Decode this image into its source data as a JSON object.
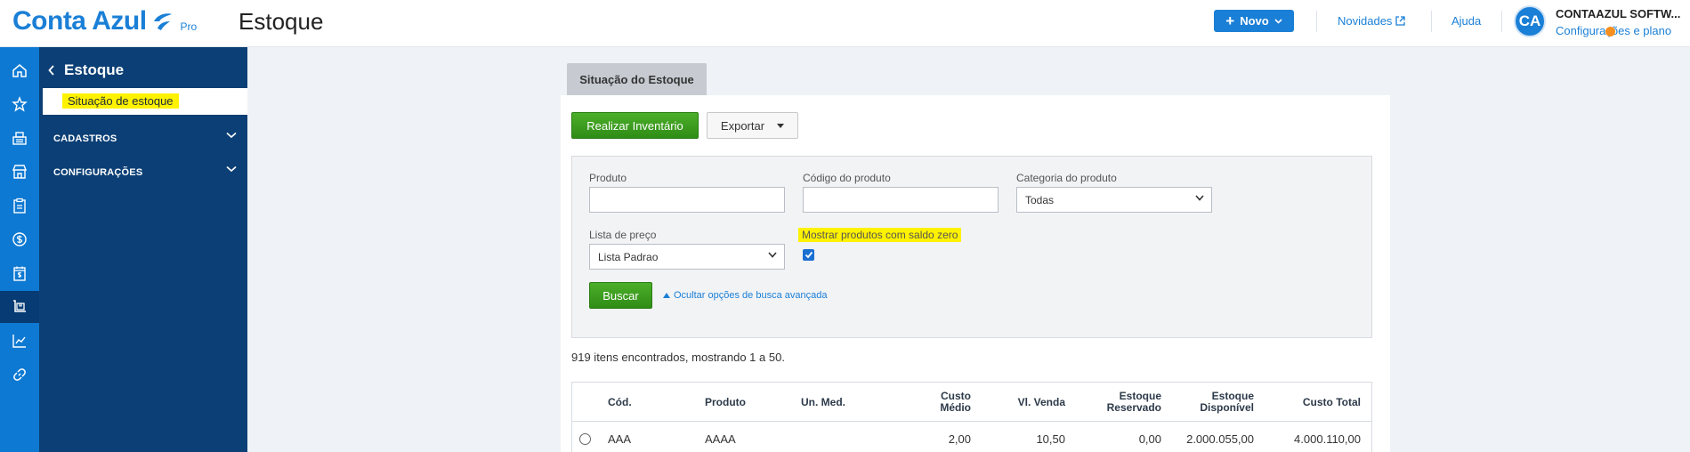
{
  "header": {
    "logo_text": "Conta Azul",
    "logo_badge": "Pro",
    "page_title": "Estoque",
    "new_button": "Novo",
    "news_link": "Novidades",
    "help_link": "Ajuda",
    "avatar_initials": "CA",
    "company_name": "CONTAAZUL SOFTW...",
    "settings_link": "Configurações e plano",
    "brand_color": "#1a7fd6"
  },
  "rail": {
    "items": [
      "home-icon",
      "star-icon",
      "cash-register-icon",
      "store-icon",
      "clipboard-icon",
      "dollar-circle-icon",
      "calendar-dollar-icon",
      "inventory-icon",
      "chart-icon",
      "link-icon"
    ],
    "active": "inventory-icon"
  },
  "sidemenu": {
    "back_label": "Estoque",
    "active_item": "Situação de estoque",
    "groups": [
      "CADASTROS",
      "CONFIGURAÇÕES"
    ]
  },
  "main": {
    "tab_label": "Situação do Estoque",
    "inventory_button": "Realizar Inventário",
    "export_button": "Exportar",
    "filters": {
      "product_label": "Produto",
      "product_value": "",
      "code_label": "Código do produto",
      "code_value": "",
      "category_label": "Categoria do produto",
      "category_value": "Todas",
      "price_list_label": "Lista de preço",
      "price_list_value": "Lista Padrao",
      "zero_balance_label": "Mostrar produtos com saldo zero",
      "zero_balance_checked": true,
      "search_button": "Buscar",
      "advanced_toggle": "Ocultar opções de busca avançada"
    },
    "result_text": "919 itens encontrados, mostrando 1 a 50."
  },
  "table": {
    "headers": {
      "code": "Cód.",
      "product": "Produto",
      "unit": "Un. Med.",
      "avg_cost_1": "Custo",
      "avg_cost_2": "Médio",
      "sale_price": "Vl. Venda",
      "reserved_1": "Estoque",
      "reserved_2": "Reservado",
      "available_1": "Estoque",
      "available_2": "Disponível",
      "total_cost": "Custo Total"
    },
    "rows": [
      {
        "code": "AAA",
        "product": "AAAA",
        "unit": "",
        "avg_cost": "2,00",
        "sale_price": "10,50",
        "reserved": "0,00",
        "available": "2.000.055,00",
        "total_cost": "4.000.110,00"
      }
    ]
  }
}
